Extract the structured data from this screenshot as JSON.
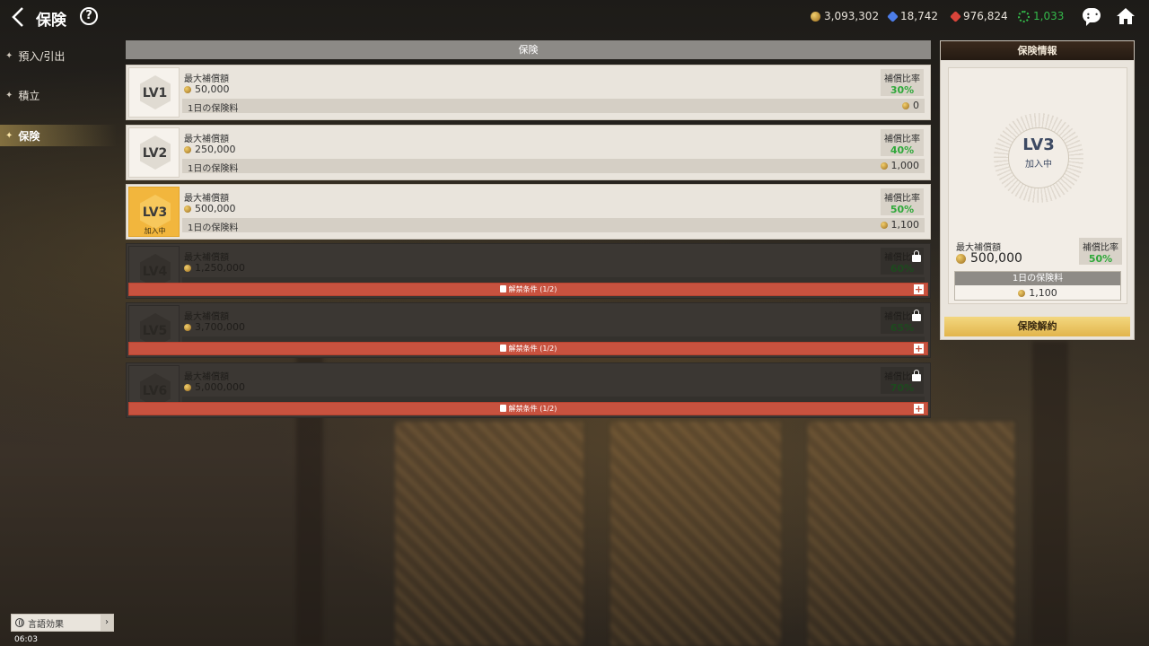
{
  "header": {
    "title": "保険",
    "help_label": "?"
  },
  "currencies": [
    {
      "name": "gold",
      "value": "3,093,302",
      "color": "#d3a743"
    },
    {
      "name": "blue-gem",
      "value": "18,742",
      "color": "#4c7de8"
    },
    {
      "name": "red-gem",
      "value": "976,824",
      "color": "#d9443a"
    },
    {
      "name": "green-gear",
      "value": "1,033",
      "color": "#34b84a"
    }
  ],
  "nav": {
    "items": [
      {
        "label": "預入/引出"
      },
      {
        "label": "積立"
      },
      {
        "label": "保険"
      }
    ],
    "active_index": 2
  },
  "main": {
    "section_title": "保険",
    "max_label": "最大補償額",
    "rate_label": "補償比率",
    "fee_label": "1日の保険料",
    "joined_label": "加入中",
    "unlock_label": "解禁条件 (1/2)",
    "levels": [
      {
        "level": "LV1",
        "max": "50,000",
        "rate": "30%",
        "fee": "0",
        "state": "available"
      },
      {
        "level": "LV2",
        "max": "250,000",
        "rate": "40%",
        "fee": "1,000",
        "state": "available"
      },
      {
        "level": "LV3",
        "max": "500,000",
        "rate": "50%",
        "fee": "1,100",
        "state": "current"
      },
      {
        "level": "LV4",
        "max": "1,250,000",
        "rate": "60%",
        "fee": "",
        "state": "locked"
      },
      {
        "level": "LV5",
        "max": "3,700,000",
        "rate": "65%",
        "fee": "",
        "state": "locked"
      },
      {
        "level": "LV6",
        "max": "5,000,000",
        "rate": "70%",
        "fee": "",
        "state": "locked"
      }
    ]
  },
  "info_panel": {
    "title": "保険情報",
    "level": "LV3",
    "status": "加入中",
    "max_label": "最大補償額",
    "max_value": "500,000",
    "rate_label": "補償比率",
    "rate_value": "50%",
    "fee_label": "1日の保険料",
    "fee_value": "1,100",
    "cancel_label": "保険解約"
  },
  "footer": {
    "language_label": "言語効果",
    "clock": "06:03"
  },
  "colors": {
    "accent_green": "#2fa83a",
    "current_badge": "#f2b63d",
    "unlock_red": "#c8523f"
  }
}
